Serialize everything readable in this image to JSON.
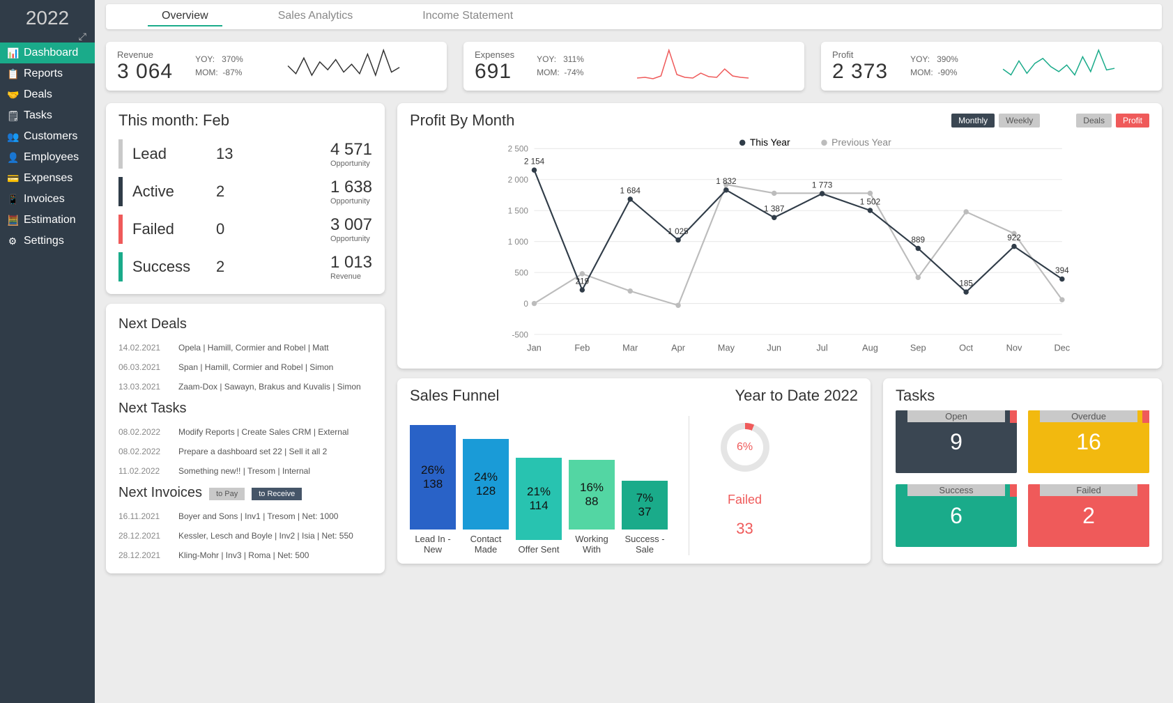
{
  "sidebar": {
    "year": "2022",
    "items": [
      {
        "label": "Dashboard",
        "icon": "📊"
      },
      {
        "label": "Reports",
        "icon": "📋"
      },
      {
        "label": "Deals",
        "icon": "🤝"
      },
      {
        "label": "Tasks",
        "icon": "🗒"
      },
      {
        "label": "Customers",
        "icon": "👥"
      },
      {
        "label": "Employees",
        "icon": "👤"
      },
      {
        "label": "Expenses",
        "icon": "💳"
      },
      {
        "label": "Invoices",
        "icon": "📱"
      },
      {
        "label": "Estimation",
        "icon": "🧮"
      },
      {
        "label": "Settings",
        "icon": "⚙"
      }
    ]
  },
  "tabs": [
    "Overview",
    "Sales Analytics",
    "Income Statement"
  ],
  "kpi": [
    {
      "label": "Revenue",
      "value": "3 064",
      "yoy": "370%",
      "mom": "-87%",
      "color": "#333"
    },
    {
      "label": "Expenses",
      "value": "691",
      "yoy": "311%",
      "mom": "-74%",
      "color": "#ef5a5a"
    },
    {
      "label": "Profit",
      "value": "2 373",
      "yoy": "390%",
      "mom": "-90%",
      "color": "#1aab8a"
    }
  ],
  "month": {
    "title": "This month: Feb",
    "rows": [
      {
        "name": "Lead",
        "num": "13",
        "big": "4 571",
        "small": "Opportunity",
        "color": "#c9c9c9"
      },
      {
        "name": "Active",
        "num": "2",
        "big": "1 638",
        "small": "Opportunity",
        "color": "#303c48"
      },
      {
        "name": "Failed",
        "num": "0",
        "big": "3 007",
        "small": "Opportunity",
        "color": "#ef5a5a"
      },
      {
        "name": "Success",
        "num": "2",
        "big": "1 013",
        "small": "Revenue",
        "color": "#1aab8a"
      }
    ]
  },
  "nextDeals": {
    "title": "Next Deals",
    "items": [
      {
        "date": "14.02.2021",
        "text": "Opela | Hamill, Cormier and Robel | Matt"
      },
      {
        "date": "06.03.2021",
        "text": "Span | Hamill, Cormier and Robel | Simon"
      },
      {
        "date": "13.03.2021",
        "text": "Zaam-Dox | Sawayn, Brakus and Kuvalis | Simon"
      }
    ]
  },
  "nextTasks": {
    "title": "Next Tasks",
    "items": [
      {
        "date": "08.02.2022",
        "text": "Modify Reports | Create Sales CRM | External"
      },
      {
        "date": "08.02.2022",
        "text": "Prepare a dashboard set 22 | Sell it all 2"
      },
      {
        "date": "11.02.2022",
        "text": "Something new!! | Tresom | Internal"
      }
    ]
  },
  "nextInvoices": {
    "title": "Next Invoices",
    "pills": {
      "pay": "to Pay",
      "receive": "to Receive"
    },
    "items": [
      {
        "date": "16.11.2021",
        "text": "Boyer and Sons | Inv1 | Tresom | Net: 1000"
      },
      {
        "date": "28.12.2021",
        "text": "Kessler, Lesch and Boyle | Inv2 | Isia | Net: 550"
      },
      {
        "date": "28.12.2021",
        "text": "Kling-Mohr | Inv3 | Roma | Net: 500"
      }
    ]
  },
  "profitChart": {
    "title": "Profit By Month",
    "toggles": {
      "monthly": "Monthly",
      "weekly": "Weekly",
      "deals": "Deals",
      "profit": "Profit"
    },
    "legend": {
      "thisYear": "This Year",
      "prevYear": "Previous Year"
    }
  },
  "chart_data": {
    "type": "line",
    "title": "Profit By Month",
    "xlabel": "",
    "ylabel": "",
    "ylim": [
      -500,
      2500
    ],
    "categories": [
      "Jan",
      "Feb",
      "Mar",
      "Apr",
      "May",
      "Jun",
      "Jul",
      "Aug",
      "Sep",
      "Oct",
      "Nov",
      "Dec"
    ],
    "series": [
      {
        "name": "This Year",
        "values": [
          2154,
          219,
          1684,
          1025,
          1832,
          1387,
          1773,
          1502,
          889,
          185,
          922,
          394
        ]
      },
      {
        "name": "Previous Year",
        "values": [
          0,
          480,
          200,
          -30,
          1920,
          1780,
          1780,
          1780,
          420,
          1480,
          1130,
          60
        ]
      }
    ]
  },
  "funnel": {
    "title": "Sales Funnel",
    "subtitle": "Year to Date 2022",
    "bars": [
      {
        "label": "Lead In - New",
        "pct": "26%",
        "count": "138",
        "h": 150,
        "color": "#2962c7"
      },
      {
        "label": "Contact Made",
        "pct": "24%",
        "count": "128",
        "h": 130,
        "color": "#1a9bd7"
      },
      {
        "label": "Offer Sent",
        "pct": "21%",
        "count": "114",
        "h": 118,
        "color": "#28c3b0"
      },
      {
        "label": "Working With",
        "pct": "16%",
        "count": "88",
        "h": 100,
        "color": "#53d6a3"
      },
      {
        "label": "Success - Sale",
        "pct": "7%",
        "count": "37",
        "h": 70,
        "color": "#1aab8a"
      }
    ],
    "side": {
      "pct": "6%",
      "label": "Failed",
      "count": "33"
    }
  },
  "tasks": {
    "title": "Tasks",
    "tiles": [
      {
        "label": "Open",
        "value": "9",
        "bg": "#3a4652"
      },
      {
        "label": "Overdue",
        "value": "16",
        "bg": "#f2b90f"
      },
      {
        "label": "Success",
        "value": "6",
        "bg": "#1aab8a"
      },
      {
        "label": "Failed",
        "value": "2",
        "bg": "#ef5a5a"
      }
    ]
  }
}
